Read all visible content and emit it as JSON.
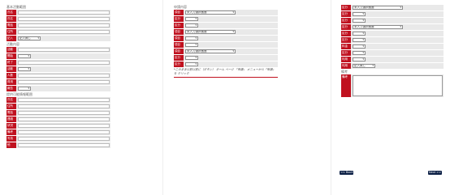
{
  "col1": {
    "sec1_title": "基本活動範囲",
    "sec1_rows": [
      {
        "label": "氏名",
        "type": "input"
      },
      {
        "label": "氏名",
        "type": "input"
      },
      {
        "label": "電話",
        "type": "input"
      },
      {
        "label": "住所",
        "type": "input"
      },
      {
        "label": "記入",
        "type": "select",
        "value": "記入無し"
      }
    ],
    "sec2_title": "活動内容",
    "sec2_rows": [
      {
        "label": "活動",
        "type": "input"
      },
      {
        "label": "開始",
        "type": "select",
        "value": ""
      },
      {
        "label": "終了",
        "type": "input"
      },
      {
        "label": "活動",
        "type": "select",
        "value": ""
      },
      {
        "label": "人数",
        "type": "input"
      },
      {
        "label": "費用",
        "type": "input"
      },
      {
        "label": "報告",
        "type": "select",
        "value": ""
      }
    ],
    "sec3_title": "提供可能情報範囲",
    "sec3_rows": [
      {
        "label": "氏名",
        "type": "input"
      },
      {
        "label": "住所",
        "type": "input"
      },
      {
        "label": "電話",
        "type": "input"
      },
      {
        "label": "連絡",
        "type": "input"
      },
      {
        "label": "状況",
        "type": "input"
      },
      {
        "label": "備考",
        "type": "input"
      },
      {
        "label": "写真",
        "type": "input"
      },
      {
        "label": "他",
        "type": "input"
      }
    ]
  },
  "col2": {
    "title": "申請内容",
    "rows": [
      {
        "label": "項目",
        "type": "select",
        "value": "未入力選択画面"
      },
      {
        "label": "区分",
        "type": "select",
        "value": ""
      },
      {
        "label": "区分",
        "type": "select",
        "value": ""
      },
      {
        "label": "項目",
        "type": "select",
        "value": "未入力選択画面"
      },
      {
        "label": "項目",
        "type": "select",
        "value": ""
      },
      {
        "label": "項目",
        "type": "select",
        "value": ""
      },
      {
        "label": "項目",
        "type": "select",
        "value": "未入力選択画面"
      },
      {
        "label": "区分",
        "type": "select",
        "value": ""
      },
      {
        "label": "区分",
        "type": "select",
        "value": ""
      }
    ],
    "note": "*このまま以前以前に（ボタン） ホーム ページ 「申請」 メニューから「申請」を クリック"
  },
  "col3": {
    "rows": [
      {
        "label": "区分",
        "type": "select",
        "value": "未入力選択画面"
      },
      {
        "label": "区分",
        "type": "select",
        "value": ""
      },
      {
        "label": "区分",
        "type": "select",
        "value": ""
      },
      {
        "label": "区分",
        "type": "select",
        "value": "未入力選択画面"
      },
      {
        "label": "区分",
        "type": "select",
        "value": ""
      },
      {
        "label": "区分",
        "type": "select",
        "value": ""
      },
      {
        "label": "料金",
        "type": "select",
        "value": ""
      },
      {
        "label": "区分",
        "type": "select",
        "value": ""
      },
      {
        "label": "利用",
        "type": "select",
        "value": ""
      },
      {
        "label": "利用",
        "type": "select",
        "value": "記入無し"
      }
    ],
    "remarks_title": "備考",
    "remarks_label": "備考",
    "back_button": "<< Back",
    "next_button": "Next >>"
  },
  "colors": {
    "accent": "#c0111f",
    "navy": "#0b1f45"
  }
}
